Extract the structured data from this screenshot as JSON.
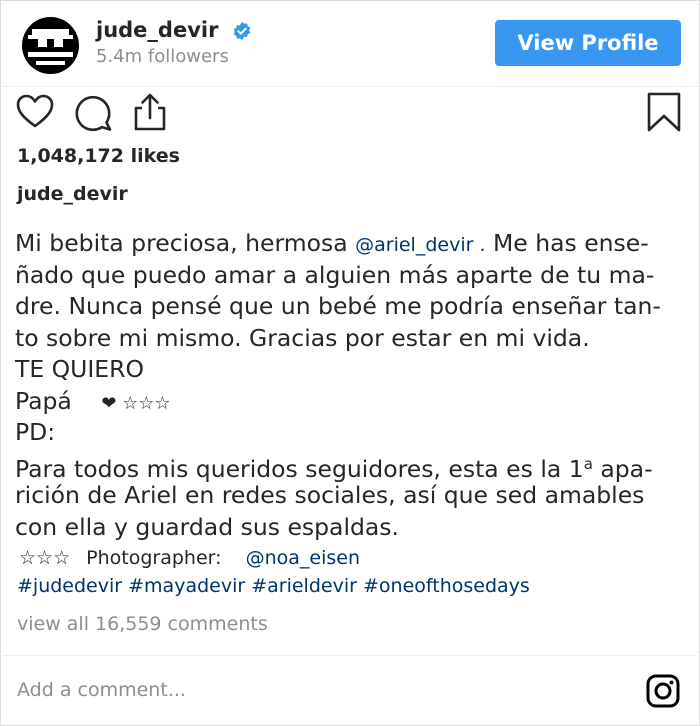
{
  "header": {
    "username": "jude_devir",
    "followers": "5.4m followers",
    "view_profile_label": "View Profile",
    "accent_color": "#3897f0",
    "verified_icon": "verified-badge-icon"
  },
  "actions": {
    "icons": [
      "heart-icon",
      "comment-icon",
      "share-icon",
      "bookmark-icon"
    ],
    "likes": "1,048,172 likes"
  },
  "post": {
    "author": "jude_devir",
    "caption": {
      "l1_text": "Mi bebita preciosa, hermosa",
      "l1_mention": "@ariel_devir .",
      "l1_tail": " Me has ense-",
      "l2": "ñado que puedo amar a alguien más aparte de tu ma-",
      "l3": "dre. Nunca pensé que un bebé me podría enseñar tan-",
      "l4": "to sobre mi mismo. Gracias por estar en mi vida.",
      "l5": "TE QUIERO",
      "l6_text": "Papá",
      "l6_symbols": "❤ ☆☆☆",
      "l7": "PD:",
      "l8_a": "Para todos mis queridos seguidores, esta es la 1",
      "l8_sup": "a",
      "l8_b": " apa-",
      "l9": "rición de Ariel en redes sociales, así que sed amables",
      "l10": "con ella y guardad sus espaldas."
    },
    "photographer_stars": "☆☆☆",
    "photographer_label": "Photographer:",
    "photographer_handle": "@noa_eisen",
    "hashtags": [
      "#judedevir",
      "#mayadevir",
      "#arieldevir",
      "#oneofthosedays"
    ],
    "view_comments": "view all 16,559 comments"
  },
  "footer": {
    "comment_placeholder": "Add a comment...",
    "instagram_icon": "instagram-icon"
  }
}
